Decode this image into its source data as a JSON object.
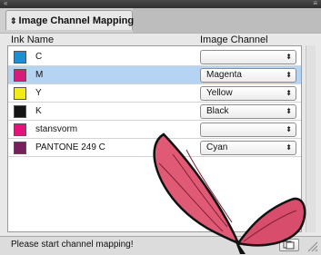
{
  "panel": {
    "title": "Image Channel Mapping",
    "col_ink": "Ink Name",
    "col_channel": "Image Channel"
  },
  "rows": [
    {
      "name": "C",
      "swatch": "#1f8fcf",
      "channel": "",
      "selected": false
    },
    {
      "name": "M",
      "swatch": "#d81a7a",
      "channel": "Magenta",
      "selected": true
    },
    {
      "name": "Y",
      "swatch": "#f3ea1a",
      "channel": "Yellow",
      "selected": false
    },
    {
      "name": "K",
      "swatch": "#141414",
      "channel": "Black",
      "selected": false
    },
    {
      "name": "stansvorm",
      "swatch": "#e2147c",
      "channel": "",
      "selected": false
    },
    {
      "name": "PANTONE 249 C",
      "swatch": "#7a1f5e",
      "channel": "Cyan",
      "selected": false
    }
  ],
  "status": {
    "text": "Please start channel mapping!"
  },
  "colors": {
    "selection": "#b5d3f2",
    "butterfly_wing": "#e0607a"
  }
}
